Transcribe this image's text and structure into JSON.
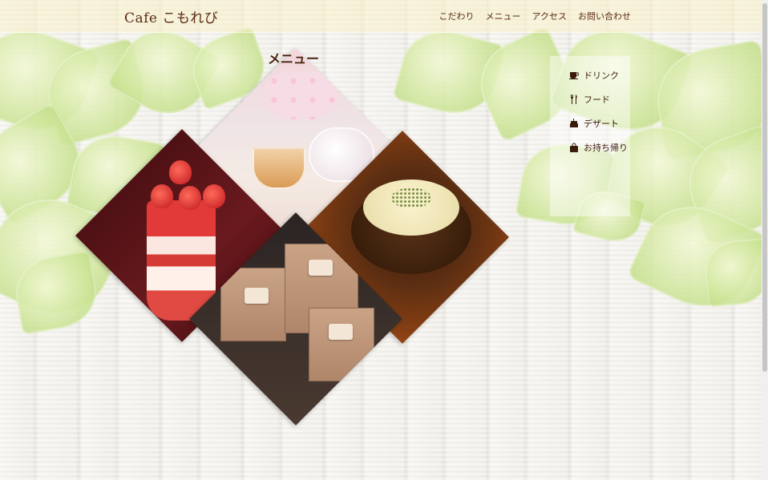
{
  "header": {
    "logo": "Cafe こもれび",
    "nav": [
      "こだわり",
      "メニュー",
      "アクセス",
      "お問い合わせ"
    ]
  },
  "page": {
    "title": "メニュー"
  },
  "side_menu": {
    "items": [
      {
        "label": "ドリンク",
        "icon": "cup-icon"
      },
      {
        "label": "フード",
        "icon": "fork-knife-icon"
      },
      {
        "label": "デザート",
        "icon": "cake-icon"
      },
      {
        "label": "お持ち帰り",
        "icon": "bag-icon"
      }
    ]
  },
  "colors": {
    "text": "#5a2a12",
    "header_bg": "#faf0c8",
    "leaf": "#cfe69a"
  }
}
